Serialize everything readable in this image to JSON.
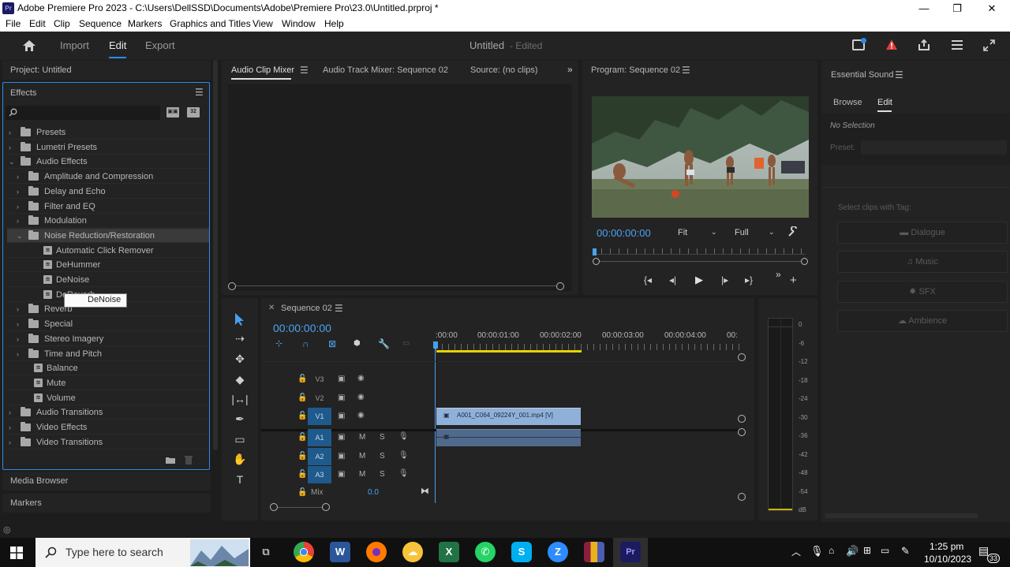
{
  "window": {
    "title": "Adobe Premiere Pro 2023 - C:\\Users\\DellSSD\\Documents\\Adobe\\Premiere Pro\\23.0\\Untitled.prproj *",
    "app_icon": "Pr",
    "minimize": "—",
    "maximize": "❐",
    "close": "✕"
  },
  "menu": [
    "File",
    "Edit",
    "Clip",
    "Sequence",
    "Markers",
    "Graphics and Titles",
    "View",
    "Window",
    "Help"
  ],
  "header": {
    "tabs": [
      "Import",
      "Edit",
      "Export"
    ],
    "active_tab": "Edit",
    "project_name": "Untitled",
    "project_status": "- Edited"
  },
  "project_panel": {
    "title": "Project: Untitled"
  },
  "effects_panel": {
    "title": "Effects",
    "search_placeholder": "",
    "badge_a": "32",
    "tree": [
      {
        "label": "Presets",
        "level": 0,
        "kind": "folder",
        "open": false
      },
      {
        "label": "Lumetri Presets",
        "level": 0,
        "kind": "folder",
        "open": false
      },
      {
        "label": "Audio Effects",
        "level": 0,
        "kind": "folder",
        "open": true
      },
      {
        "label": "Amplitude and Compression",
        "level": 1,
        "kind": "folder",
        "open": false
      },
      {
        "label": "Delay and Echo",
        "level": 1,
        "kind": "folder",
        "open": false
      },
      {
        "label": "Filter and EQ",
        "level": 1,
        "kind": "folder",
        "open": false
      },
      {
        "label": "Modulation",
        "level": 1,
        "kind": "folder",
        "open": false
      },
      {
        "label": "Noise Reduction/Restoration",
        "level": 1,
        "kind": "folder",
        "open": true,
        "selected": true
      },
      {
        "label": "Automatic Click Remover",
        "level": 2,
        "kind": "effect"
      },
      {
        "label": "DeHummer",
        "level": 2,
        "kind": "effect"
      },
      {
        "label": "DeNoise",
        "level": 2,
        "kind": "effect"
      },
      {
        "label": "DeReverb",
        "level": 2,
        "kind": "effect"
      },
      {
        "label": "Reverb",
        "level": 1,
        "kind": "folder",
        "open": false
      },
      {
        "label": "Special",
        "level": 1,
        "kind": "folder",
        "open": false
      },
      {
        "label": "Stereo Imagery",
        "level": 1,
        "kind": "folder",
        "open": false
      },
      {
        "label": "Time and Pitch",
        "level": 1,
        "kind": "folder",
        "open": false
      },
      {
        "label": "Balance",
        "level": 1,
        "kind": "effect"
      },
      {
        "label": "Mute",
        "level": 1,
        "kind": "effect"
      },
      {
        "label": "Volume",
        "level": 1,
        "kind": "effect"
      },
      {
        "label": "Audio Transitions",
        "level": 0,
        "kind": "folder",
        "open": false
      },
      {
        "label": "Video Effects",
        "level": 0,
        "kind": "folder",
        "open": false
      },
      {
        "label": "Video Transitions",
        "level": 0,
        "kind": "folder",
        "open": false
      }
    ],
    "tooltip": "DeNoise"
  },
  "lower_panels": [
    "Media Browser",
    "Markers"
  ],
  "mixer_tabs": [
    "Audio Clip Mixer",
    "Audio Track Mixer: Sequence 02",
    "Source: (no clips)"
  ],
  "program": {
    "title": "Program: Sequence 02",
    "timecode": "00:00:00:00",
    "fit": "Fit",
    "quality": "Full"
  },
  "essential_sound": {
    "title": "Essential Sound",
    "tabs": [
      "Browse",
      "Edit"
    ],
    "active_tab": "Edit",
    "no_selection": "No Selection",
    "preset_label": "Preset:",
    "tag_hint": "Select clips with Tag:",
    "buttons": [
      "Dialogue",
      "Music",
      "SFX",
      "Ambience"
    ]
  },
  "timeline": {
    "sequence": "Sequence 02",
    "timecode": "00:00:00:00",
    "ruler": [
      ":00:00",
      "00:00:01:00",
      "00:00:02:00",
      "00:00:03:00",
      "00:00:04:00",
      "00:"
    ],
    "video_tracks": [
      "V3",
      "V2",
      "V1"
    ],
    "audio_tracks": [
      "A1",
      "A2",
      "A3"
    ],
    "mix_label": "Mix",
    "mix_value": "0.0",
    "clip_name": "A001_C064_09224Y_001.mp4 [V]",
    "m_label": "M",
    "s_label": "S"
  },
  "meter_labels": [
    "0",
    "-6",
    "-12",
    "-18",
    "-24",
    "-30",
    "-36",
    "-42",
    "-48",
    "-54",
    "dB"
  ],
  "taskbar": {
    "search_placeholder": "Type here to search",
    "time": "1:25 pm",
    "date": "10/10/2023",
    "notif_count": "33"
  }
}
